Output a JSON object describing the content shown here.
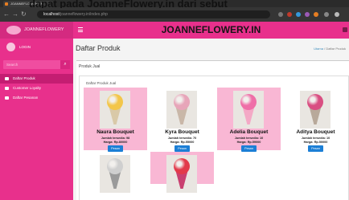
{
  "caption": "dapat pada JoanneFlowery.in dari sebut",
  "browser": {
    "tab_title": "JOANNEFLOWERY.IN",
    "url_host": "localhost",
    "url_path": "/joanneflowery.in/index.php"
  },
  "sidebar": {
    "brand": "JOANNEFLOWERY",
    "user": "LOGIN",
    "search_placeholder": "Search",
    "items": [
      {
        "label": "Daftar Produk",
        "active": true
      },
      {
        "label": "Customer Loyalty",
        "active": false
      },
      {
        "label": "Daftar Pesanan",
        "active": false
      }
    ]
  },
  "header": {
    "title": "JOANNEFLOWERY.IN"
  },
  "main": {
    "page_title": "Daftar Produk",
    "breadcrumb_home": "Utama",
    "breadcrumb_current": "Daftar Produk",
    "box_title": "Produk Jual",
    "inner_title": "Daftar Produk Jual",
    "products": [
      {
        "name": "Naura Bouquet",
        "stock": "Jumlah tersedia: 98",
        "price": "Harga: Rp.80000",
        "button": "Pesan",
        "bg": "#f9b7d4",
        "flower": "#f3c64a",
        "paper": "#d9c9a8"
      },
      {
        "name": "Kyra Bouquet",
        "stock": "Jumlah tersedia: 70",
        "price": "Harga: Rp.55000",
        "button": "Pesan",
        "bg": "#ffffff",
        "flower": "#e7a5b9",
        "paper": "#c9b7a8"
      },
      {
        "name": "Adelia Bouquet",
        "stock": "Jumlah tersedia: 10",
        "price": "Harga: Rp.59000",
        "button": "Pesan",
        "bg": "#f9b7d4",
        "flower": "#ef6fa8",
        "paper": "#f4a9c6"
      },
      {
        "name": "Aditya Bouquet",
        "stock": "Jumlah tersedia: 10",
        "price": "Harga: Rp.50000",
        "button": "Pesan",
        "bg": "#ffffff",
        "flower": "#d94f82",
        "paper": "#b8a99a"
      }
    ],
    "second_row": [
      {
        "bg": "#ffffff",
        "flower": "#cfcfcf",
        "paper": "#9a9a9a"
      },
      {
        "bg": "#f9b7d4",
        "flower": "#e23a4a",
        "paper": "#c94070"
      }
    ]
  }
}
